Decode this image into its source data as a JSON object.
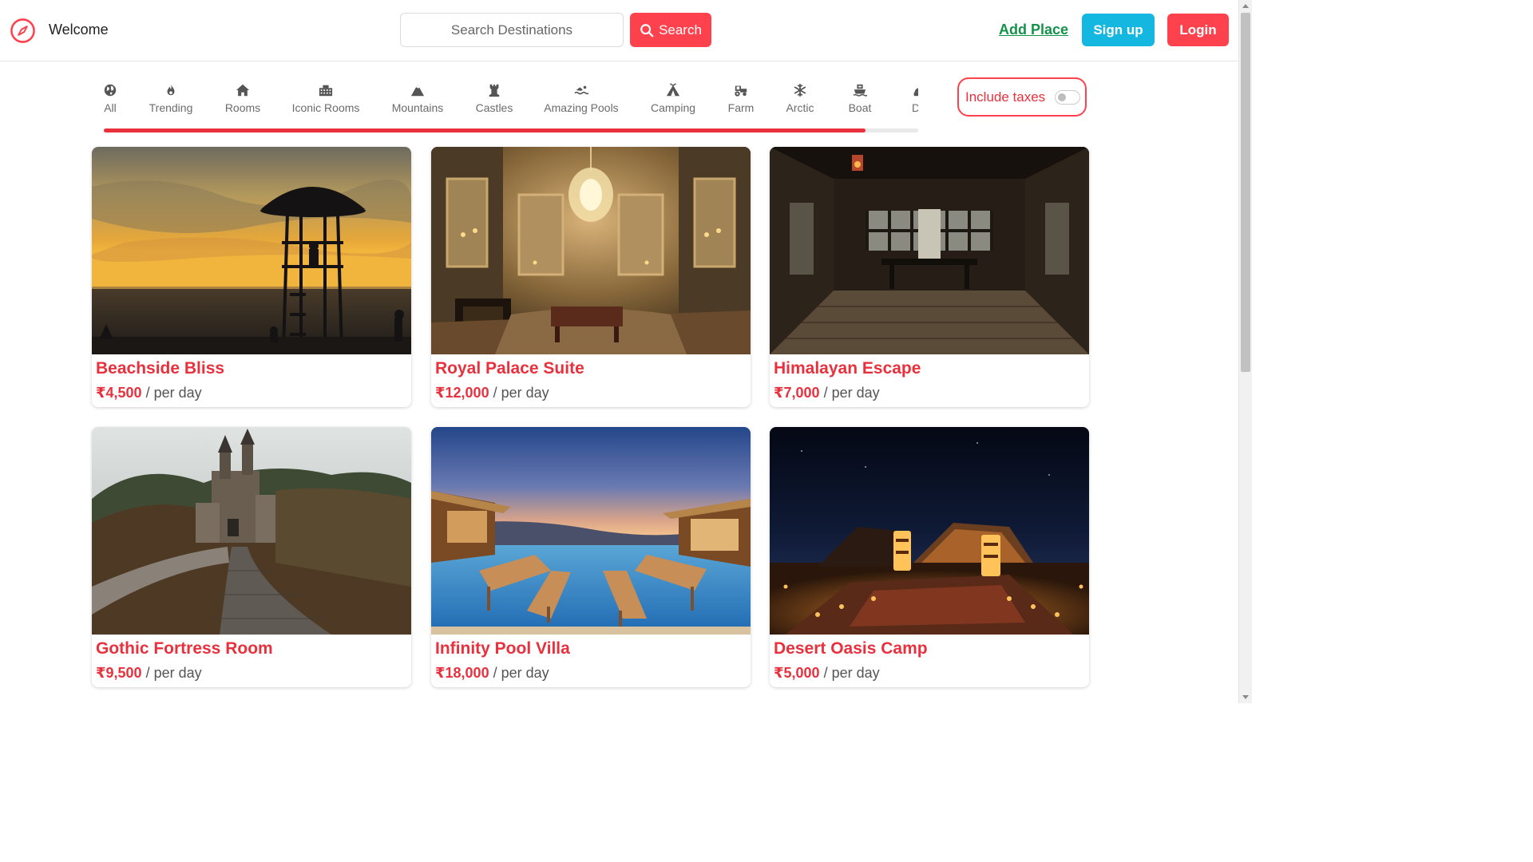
{
  "navbar": {
    "brand_text": "Welcome",
    "brand_icon": "compass-icon",
    "search_placeholder": "Search Destinations",
    "search_label": "Search",
    "add_place_label": "Add Place",
    "signup_label": "Sign up",
    "login_label": "Login"
  },
  "filters": {
    "items": [
      {
        "label": "All",
        "icon": "globe-icon"
      },
      {
        "label": "Trending",
        "icon": "fire-icon"
      },
      {
        "label": "Rooms",
        "icon": "house-icon"
      },
      {
        "label": "Iconic Rooms",
        "icon": "city-icon"
      },
      {
        "label": "Mountains",
        "icon": "mountain-icon"
      },
      {
        "label": "Castles",
        "icon": "castle-icon"
      },
      {
        "label": "Amazing Pools",
        "icon": "swimmer-icon"
      },
      {
        "label": "Camping",
        "icon": "tent-icon"
      },
      {
        "label": "Farm",
        "icon": "tractor-icon"
      },
      {
        "label": "Arctic",
        "icon": "snowflake-icon"
      },
      {
        "label": "Boat",
        "icon": "ship-icon"
      },
      {
        "label": "Do",
        "icon": "dome-icon"
      }
    ],
    "scroll_progress": 0.935
  },
  "tax_toggle": {
    "label": "Include taxes",
    "enabled": false
  },
  "listings": [
    {
      "title": "Beachside Bliss",
      "price": "₹4,500",
      "unit": " / per day",
      "image": "beach-sunset-hut-image"
    },
    {
      "title": "Royal Palace Suite",
      "price": "₹12,000",
      "unit": " / per day",
      "image": "palace-chandelier-room-image"
    },
    {
      "title": "Himalayan Escape",
      "price": "₹7,000",
      "unit": " / per day",
      "image": "wooden-cabin-interior-image"
    },
    {
      "title": "Gothic Fortress Room",
      "price": "₹9,500",
      "unit": " / per day",
      "image": "forest-castle-image"
    },
    {
      "title": "Infinity Pool Villa",
      "price": "₹18,000",
      "unit": " / per day",
      "image": "infinity-pool-sunset-image"
    },
    {
      "title": "Desert Oasis Camp",
      "price": "₹5,000",
      "unit": " / per day",
      "image": "desert-night-camp-image"
    }
  ],
  "colors": {
    "accent": "#fe424d",
    "accent_text": "#e8313d",
    "signup": "#13b7e0",
    "add_place": "#15924a"
  }
}
